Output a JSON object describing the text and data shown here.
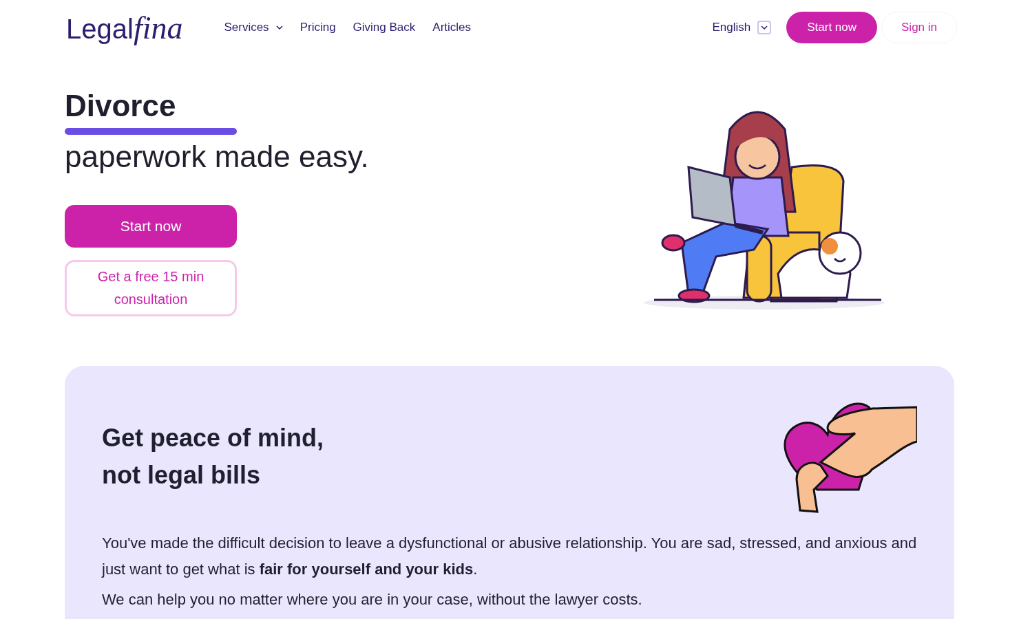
{
  "header": {
    "logo": "Legal",
    "logo_script": "fina",
    "nav": [
      {
        "label": "Services",
        "dropdown": true
      },
      {
        "label": "Pricing",
        "dropdown": false
      },
      {
        "label": "Giving Back",
        "dropdown": false
      },
      {
        "label": "Articles",
        "dropdown": false
      }
    ],
    "language": "English",
    "start_button": "Start now",
    "sign_in": "Sign in"
  },
  "hero": {
    "title": "Divorce",
    "subtitle": "paperwork made easy.",
    "primary_button": "Start now",
    "secondary_button": "Get a free 15 min consultation"
  },
  "info": {
    "heading_lines": [
      "Get peace of mind,",
      "not legal bills"
    ],
    "paragraphs": [
      "You've made the difficult decision to leave a dysfunctional or abusive relationship. You are sad, stressed, and anxious and just want to get what is **fair for yourself and your kids**.",
      "We can help you no matter where you are in your case, without the lawyer costs."
    ]
  }
}
